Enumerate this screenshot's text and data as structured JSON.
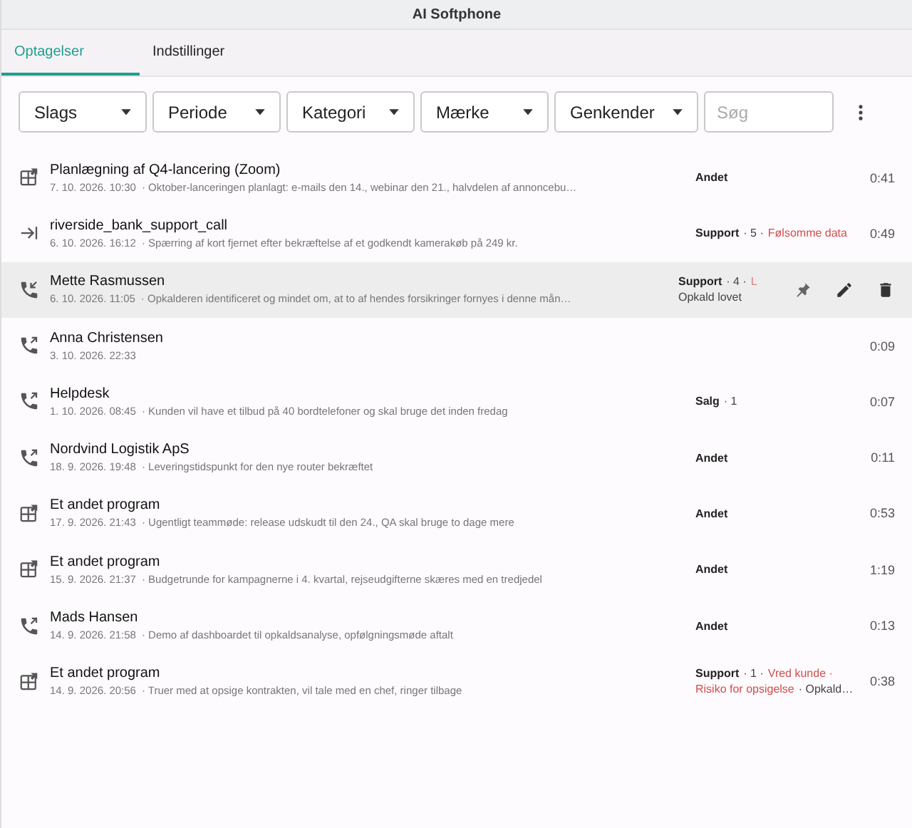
{
  "window": {
    "title": "AI Softphone"
  },
  "tabs": [
    {
      "label": "Optagelser",
      "selected": true
    },
    {
      "label": "Indstillinger",
      "selected": false
    }
  ],
  "filters": [
    {
      "label": "Slags"
    },
    {
      "label": "Periode"
    },
    {
      "label": "Kategori"
    },
    {
      "label": "Mærke"
    },
    {
      "label": "Genkender"
    }
  ],
  "search": {
    "placeholder": "Søg"
  },
  "recordings": [
    {
      "kind": "app",
      "title": "Planlægning af Q4-lancering (Zoom)",
      "date": "7. 10. 2026. 10:30",
      "summary": "· Oktober-lanceringen planlagt: e-mails den 14., webinar den 21., halvdelen af annoncebu…",
      "hovered": false,
      "tags": [
        [
          {
            "kind": "category",
            "text": "Andet"
          }
        ]
      ],
      "duration": "0:41"
    },
    {
      "kind": "forward",
      "title": "riverside_bank_support_call",
      "date": "6. 10. 2026. 16:12",
      "summary": "· Spærring af kort fjernet efter bekræftelse af et godkendt kamerakøb på 249 kr.",
      "hovered": false,
      "tags": [
        [
          {
            "kind": "category",
            "text": "Support"
          },
          {
            "kind": "count",
            "text": "· 5 ·"
          },
          {
            "kind": "warning",
            "text": "Følsomme data"
          }
        ]
      ],
      "duration": "0:49"
    },
    {
      "kind": "incoming",
      "title": "Mette Rasmussen",
      "date": "6. 10. 2026. 11:05",
      "summary": "· Opkalderen identificeret og mindet om, at to af hendes forsikringer fornyes i denne mån…",
      "hovered": true,
      "tags": [
        [
          {
            "kind": "category",
            "text": "Support"
          },
          {
            "kind": "count",
            "text": "· 4 ·"
          },
          {
            "kind": "warning",
            "text": "L"
          }
        ],
        [
          {
            "kind": "note",
            "text": "Opkald lovet"
          }
        ]
      ]
    },
    {
      "kind": "outgoing",
      "title": "Anna Christensen",
      "date": "3. 10. 2026. 22:33",
      "hovered": false,
      "duration": "0:09"
    },
    {
      "kind": "outgoing",
      "title": "Helpdesk",
      "date": "1. 10. 2026. 08:45",
      "summary": "· Kunden vil have et tilbud på 40 bordtelefoner og skal bruge det inden fredag",
      "hovered": false,
      "tags": [
        [
          {
            "kind": "category",
            "text": "Salg"
          },
          {
            "kind": "count",
            "text": "· 1"
          }
        ]
      ],
      "duration": "0:07"
    },
    {
      "kind": "outgoing",
      "title": "Nordvind Logistik ApS",
      "date": "18. 9. 2026. 19:48",
      "summary": "· Leveringstidspunkt for den nye router bekræftet",
      "hovered": false,
      "tags": [
        [
          {
            "kind": "category",
            "text": "Andet"
          }
        ]
      ],
      "duration": "0:11"
    },
    {
      "kind": "app",
      "title": "Et andet program",
      "date": "17. 9. 2026. 21:43",
      "summary": "· Ugentligt teammøde: release udskudt til den 24., QA skal bruge to dage mere",
      "hovered": false,
      "tags": [
        [
          {
            "kind": "category",
            "text": "Andet"
          }
        ]
      ],
      "duration": "0:53"
    },
    {
      "kind": "app",
      "title": "Et andet program",
      "date": "15. 9. 2026. 21:37",
      "summary": "· Budgetrunde for kampagnerne i 4. kvartal, rejseudgifterne skæres med en tredjedel",
      "hovered": false,
      "tags": [
        [
          {
            "kind": "category",
            "text": "Andet"
          }
        ]
      ],
      "duration": "1:19"
    },
    {
      "kind": "outgoing",
      "title": "Mads Hansen",
      "date": "14. 9. 2026. 21:58",
      "summary": "· Demo af dashboardet til opkaldsanalyse, opfølgningsmøde aftalt",
      "hovered": false,
      "tags": [
        [
          {
            "kind": "category",
            "text": "Andet"
          }
        ]
      ],
      "duration": "0:13"
    },
    {
      "kind": "app",
      "title": "Et andet program",
      "date": "14. 9. 2026. 20:56",
      "summary": "· Truer med at opsige kontrakten, vil tale med en chef, ringer tilbage",
      "hovered": false,
      "tags": [
        [
          {
            "kind": "category",
            "text": "Support"
          },
          {
            "kind": "count",
            "text": "· 1 ·"
          },
          {
            "kind": "warning",
            "text": "Vred kunde ·"
          }
        ],
        [
          {
            "kind": "warning",
            "text": "Risiko for opsigelse"
          },
          {
            "kind": "note",
            "text": "· Opkald…"
          }
        ]
      ],
      "duration": "0:38"
    }
  ]
}
